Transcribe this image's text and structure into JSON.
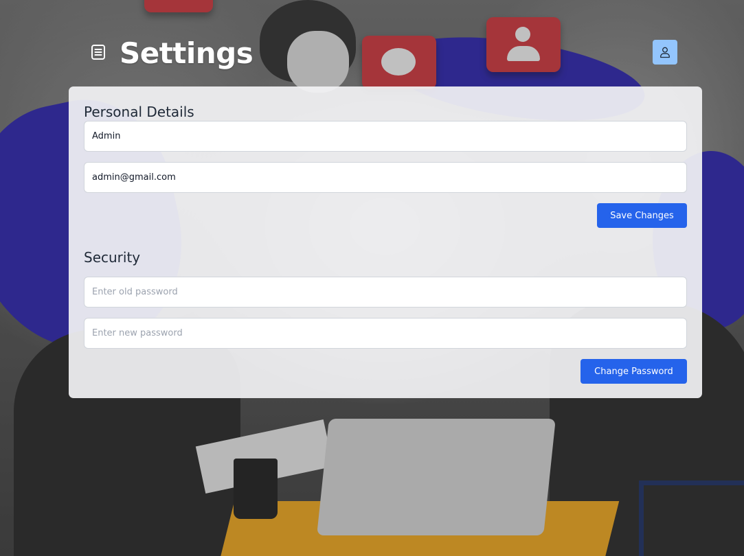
{
  "header": {
    "title": "Settings",
    "menu_icon": "list-icon",
    "profile_icon": "user-icon",
    "profile_button_color": "#93c5fd"
  },
  "personal_details": {
    "heading": "Personal Details",
    "name_value": "Admin",
    "email_value": "admin@gmail.com",
    "save_label": "Save Changes"
  },
  "security": {
    "heading": "Security",
    "old_password_placeholder": "Enter old password",
    "new_password_placeholder": "Enter new password",
    "change_label": "Change Password"
  },
  "colors": {
    "accent": "#2563eb",
    "card_background": "#f3f3f5",
    "heading_text": "#1f2937"
  }
}
